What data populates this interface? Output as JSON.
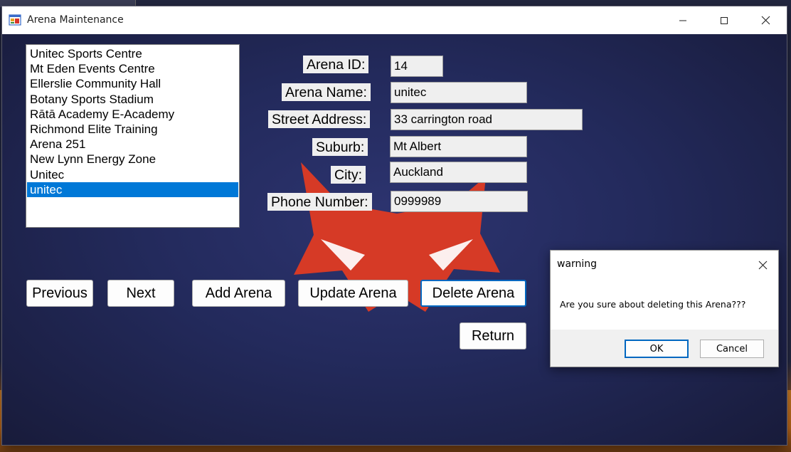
{
  "window": {
    "title": "Arena Maintenance",
    "controls": [
      "minimize-icon",
      "maximize-icon",
      "close-icon"
    ]
  },
  "arena_list": {
    "items": [
      "Unitec Sports Centre",
      "Mt Eden Events Centre",
      "Ellerslie Community Hall",
      "Botany Sports Stadium",
      "Rātā Academy E-Academy",
      "Richmond Elite Training",
      "Arena 251",
      "New Lynn Energy Zone",
      "Unitec",
      "unitec"
    ],
    "selected_index": 9
  },
  "form": {
    "arena_id_label": "Arena ID:",
    "arena_id_value": "14",
    "arena_name_label": "Arena Name:",
    "arena_name_value": "unitec",
    "street_label": "Street Address:",
    "street_value": "33 carrington road",
    "suburb_label": "Suburb:",
    "suburb_value": "Mt Albert",
    "city_label": "City:",
    "city_value": "Auckland",
    "phone_label": "Phone Number:",
    "phone_value": "0999989"
  },
  "buttons": {
    "previous": "Previous",
    "next": "Next",
    "add": "Add Arena",
    "update": "Update Arena",
    "delete": "Delete Arena",
    "return": "Return"
  },
  "dialog": {
    "title": "warning",
    "message": "Are you sure about deleting this Arena???",
    "ok": "OK",
    "cancel": "Cancel"
  },
  "colors": {
    "selection": "#0078d7",
    "focus_border": "#0067c0",
    "background": "#232a5c",
    "logo": "#d63a26"
  }
}
